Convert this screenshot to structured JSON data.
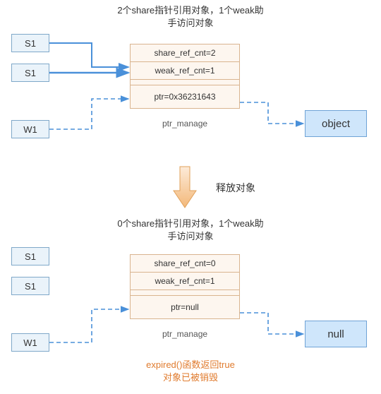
{
  "top": {
    "title_line1": "2个share指针引用对象，1个weak助",
    "title_line2": "手访问对象",
    "pointers": {
      "s1a": "S1",
      "s1b": "S1",
      "w1": "W1"
    },
    "manage": {
      "share_ref": "share_ref_cnt=2",
      "weak_ref": "weak_ref_cnt=1",
      "ptr": "ptr=0x36231643",
      "label": "ptr_manage"
    },
    "object": "object"
  },
  "middle": {
    "label": "释放对象"
  },
  "bottom": {
    "title_line1": "0个share指针引用对象，1个weak助",
    "title_line2": "手访问对象",
    "pointers": {
      "s1a": "S1",
      "s1b": "S1",
      "w1": "W1"
    },
    "manage": {
      "share_ref": "share_ref_cnt=0",
      "weak_ref": "weak_ref_cnt=1",
      "ptr": "ptr=null",
      "label": "ptr_manage"
    },
    "object": "null"
  },
  "footer": {
    "line1": "expired()函数返回true",
    "line2": "对象已被销毁"
  },
  "chart_data": {
    "type": "diagram",
    "description": "Shared/weak pointer reference counting before and after object release",
    "states": [
      {
        "name": "before_release",
        "share_ref_cnt": 2,
        "weak_ref_cnt": 1,
        "ptr": "0x36231643",
        "object_alive": true,
        "pointers": [
          "S1",
          "S1",
          "W1"
        ]
      },
      {
        "name": "after_release",
        "share_ref_cnt": 0,
        "weak_ref_cnt": 1,
        "ptr": null,
        "object_alive": false,
        "pointers": [
          "S1",
          "S1",
          "W1"
        ],
        "expired_returns": true
      }
    ],
    "transition": "释放对象"
  }
}
